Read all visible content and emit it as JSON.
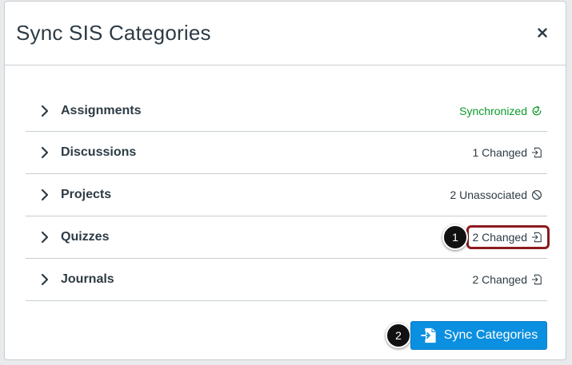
{
  "dialog": {
    "title": "Sync SIS Categories",
    "close_symbol": "×"
  },
  "categories": [
    {
      "label": "Assignments",
      "status": "Synchronized",
      "status_icon": "sync-check-icon",
      "status_color": "#0b9a2b"
    },
    {
      "label": "Discussions",
      "status": "1 Changed",
      "status_icon": "import-icon"
    },
    {
      "label": "Projects",
      "status": "2 Unassociated",
      "status_icon": "no-icon"
    },
    {
      "label": "Quizzes",
      "status": "2 Changed",
      "status_icon": "import-icon"
    },
    {
      "label": "Journals",
      "status": "2 Changed",
      "status_icon": "import-icon"
    }
  ],
  "sync_button": {
    "label": "Sync Categories",
    "icon": "import-document-icon",
    "color": "#0b8fe0"
  },
  "callouts": [
    "1",
    "2"
  ],
  "colors": {
    "text": "#2d3b45",
    "highlight": "#8b1a1f"
  }
}
